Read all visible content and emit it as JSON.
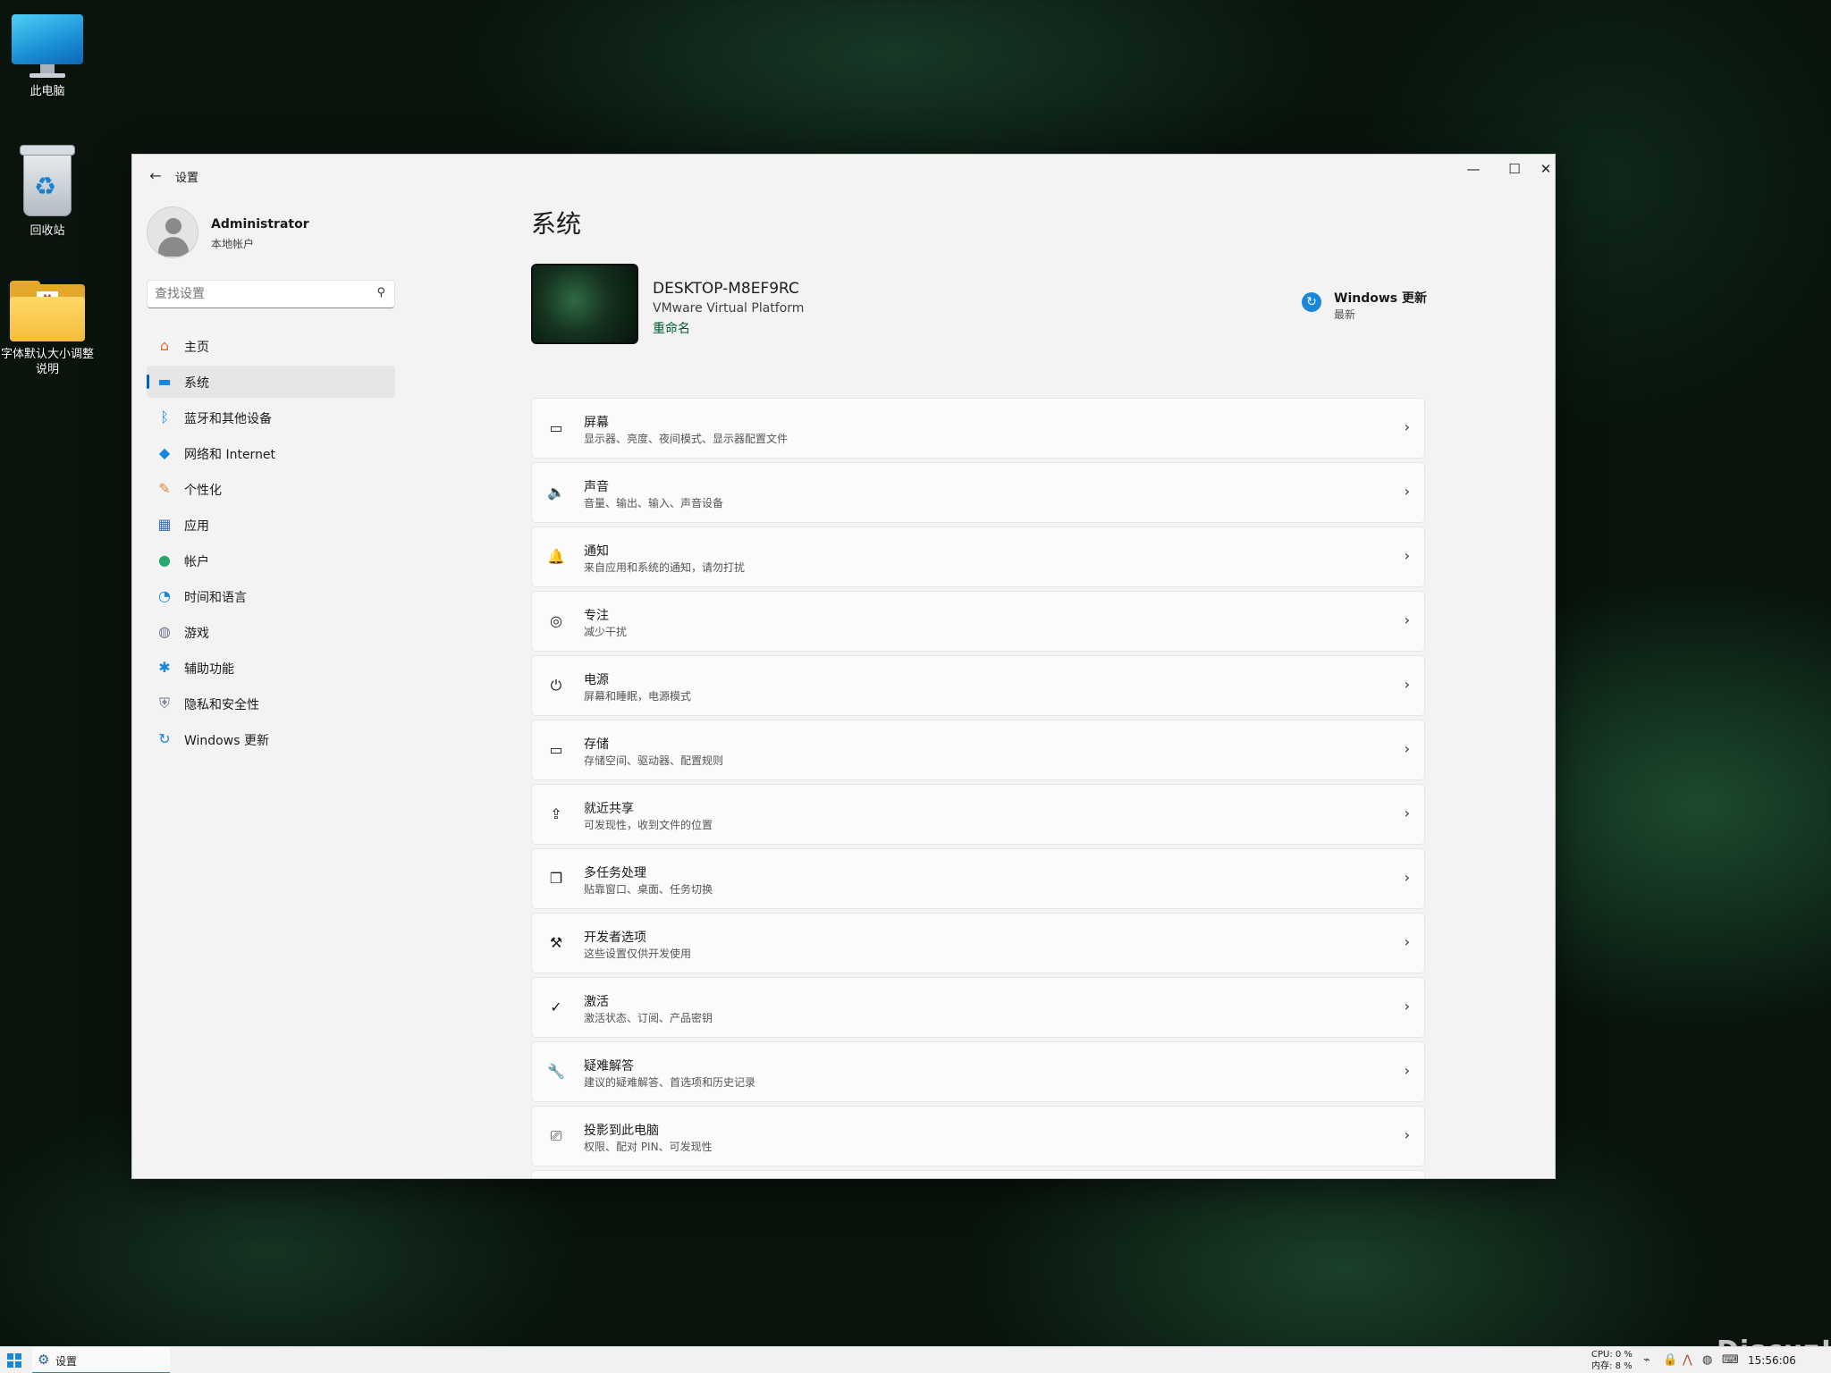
{
  "desktop": {
    "icons": [
      {
        "label": "此电脑"
      },
      {
        "label": "回收站"
      },
      {
        "label": "字体默认大小调整说明"
      }
    ]
  },
  "window": {
    "title": "设置",
    "back_glyph": "←",
    "minimize_glyph": "—",
    "maximize_glyph": "☐",
    "close_glyph": "✕"
  },
  "profile": {
    "name": "Administrator",
    "account_type": "本地帐户"
  },
  "search": {
    "placeholder": "查找设置",
    "icon_glyph": "⚲"
  },
  "nav": {
    "items": [
      {
        "label": "主页",
        "icon": "home-icon",
        "glyph": "⌂",
        "color": "#e0683a"
      },
      {
        "label": "系统",
        "icon": "monitor-icon",
        "glyph": "▬",
        "color": "#1a86d9",
        "active": true
      },
      {
        "label": "蓝牙和其他设备",
        "icon": "bluetooth-icon",
        "glyph": "ᛒ",
        "color": "#1a86d9"
      },
      {
        "label": "网络和 Internet",
        "icon": "wifi-icon",
        "glyph": "◆",
        "color": "#1a86d9"
      },
      {
        "label": "个性化",
        "icon": "brush-icon",
        "glyph": "✎",
        "color": "#d88a3a"
      },
      {
        "label": "应用",
        "icon": "apps-icon",
        "glyph": "▦",
        "color": "#3a6fb5"
      },
      {
        "label": "帐户",
        "icon": "person-icon",
        "glyph": "●",
        "color": "#26a96b"
      },
      {
        "label": "时间和语言",
        "icon": "globe-clock-icon",
        "glyph": "◔",
        "color": "#1a86d9"
      },
      {
        "label": "游戏",
        "icon": "gamepad-icon",
        "glyph": "◍",
        "color": "#6b7a8c"
      },
      {
        "label": "辅助功能",
        "icon": "accessibility-icon",
        "glyph": "✱",
        "color": "#1a86d9"
      },
      {
        "label": "隐私和安全性",
        "icon": "shield-icon",
        "glyph": "⛨",
        "color": "#6b7a8c"
      },
      {
        "label": "Windows 更新",
        "icon": "update-icon",
        "glyph": "↻",
        "color": "#1a86d9"
      }
    ]
  },
  "main": {
    "page_title": "系统",
    "device": {
      "name": "DESKTOP-M8EF9RC",
      "model": "VMware Virtual Platform",
      "rename_label": "重命名"
    },
    "windows_update": {
      "title": "Windows 更新",
      "status": "最新",
      "glyph": "↻"
    },
    "chevron_glyph": "›",
    "cards": [
      {
        "title": "屏幕",
        "subtitle": "显示器、亮度、夜间模式、显示器配置文件",
        "icon": "laptop-icon",
        "glyph": "▭"
      },
      {
        "title": "声音",
        "subtitle": "音量、输出、输入、声音设备",
        "icon": "speaker-icon",
        "glyph": "🔈"
      },
      {
        "title": "通知",
        "subtitle": "来自应用和系统的通知，请勿打扰",
        "icon": "bell-icon",
        "glyph": "🔔"
      },
      {
        "title": "专注",
        "subtitle": "减少干扰",
        "icon": "focus-icon",
        "glyph": "◎"
      },
      {
        "title": "电源",
        "subtitle": "屏幕和睡眠，电源模式",
        "icon": "power-icon",
        "glyph": "⏻"
      },
      {
        "title": "存储",
        "subtitle": "存储空间、驱动器、配置规则",
        "icon": "drive-icon",
        "glyph": "▭"
      },
      {
        "title": "就近共享",
        "subtitle": "可发现性，收到文件的位置",
        "icon": "share-icon",
        "glyph": "⇪"
      },
      {
        "title": "多任务处理",
        "subtitle": "贴靠窗口、桌面、任务切换",
        "icon": "multitask-icon",
        "glyph": "❐"
      },
      {
        "title": "开发者选项",
        "subtitle": "这些设置仅供开发使用",
        "icon": "developer-tools-icon",
        "glyph": "⚒"
      },
      {
        "title": "激活",
        "subtitle": "激活状态、订阅、产品密钥",
        "icon": "checkmark-circle-icon",
        "glyph": "✓"
      },
      {
        "title": "疑难解答",
        "subtitle": "建议的疑难解答、首选项和历史记录",
        "icon": "wrench-icon",
        "glyph": "🔧"
      },
      {
        "title": "投影到此电脑",
        "subtitle": "权限、配对 PIN、可发现性",
        "icon": "project-icon",
        "glyph": "⎚"
      }
    ]
  },
  "taskbar": {
    "app_label": "设置",
    "app_glyph": "⚙",
    "cpu_label": "CPU:",
    "cpu_value": "0 %",
    "mem_label": "内存:",
    "mem_value": "8 %",
    "clock": "15:56:06"
  },
  "watermark": "Discuz!"
}
